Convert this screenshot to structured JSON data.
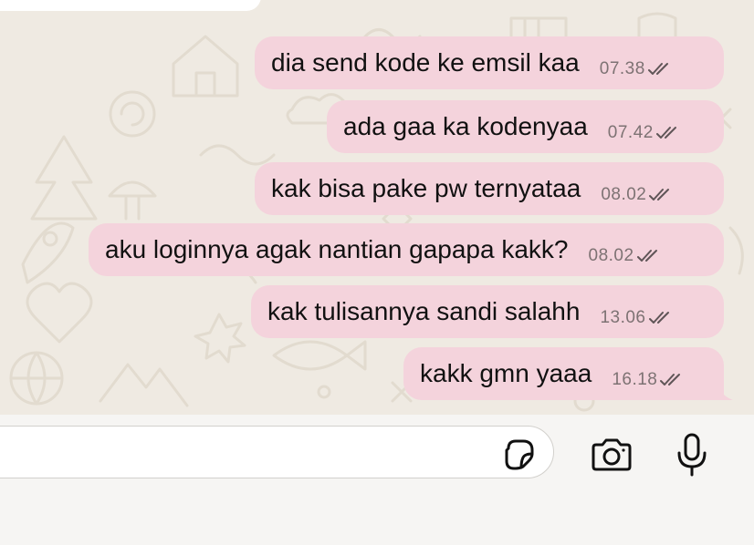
{
  "messages": [
    {
      "text": "dia send kode ke emsil kaa",
      "time": "07.38",
      "status": "read-double-check"
    },
    {
      "text": "ada gaa ka kodenyaa",
      "time": "07.42",
      "status": "read-double-check"
    },
    {
      "text": "kak bisa pake pw ternyataa",
      "time": "08.02",
      "status": "read-double-check"
    },
    {
      "text": "aku loginnya agak nantian gapapa kakk?",
      "time": "08.02",
      "status": "read-double-check"
    },
    {
      "text": "kak tulisannya sandi salahh",
      "time": "13.06",
      "status": "read-double-check"
    },
    {
      "text": "kakk gmn yaaa",
      "time": "16.18",
      "status": "read-double-check"
    }
  ],
  "composer": {
    "input_value": "",
    "icons": [
      "sticker-icon",
      "camera-icon",
      "microphone-icon"
    ]
  },
  "colors": {
    "outgoing_bubble": "#f4d3dc",
    "chat_background": "#efeae2",
    "composer_background": "#f6f5f3",
    "timestamp": "#7d7273"
  }
}
